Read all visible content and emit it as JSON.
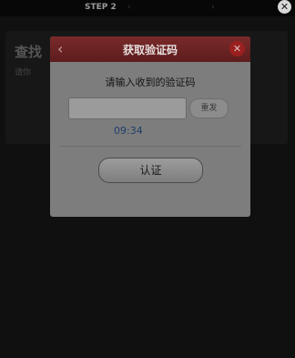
{
  "steps": {
    "step2_label": "STEP 2",
    "separator": "›"
  },
  "close_icon_glyph": "✕",
  "background": {
    "title": "查找",
    "subtitle": "请你",
    "lines": [
      "",
      "",
      ""
    ]
  },
  "dialog": {
    "title": "获取验证码",
    "back_glyph": "‹",
    "close_glyph": "✕",
    "prompt": "请输入收到的验证码",
    "code_input_value": "",
    "code_input_placeholder": "",
    "resend_label": "重发",
    "timer": "09:34",
    "verify_label": "认证"
  },
  "colors": {
    "header_red": "#c0392b",
    "timer_blue": "#1f3f6a"
  }
}
